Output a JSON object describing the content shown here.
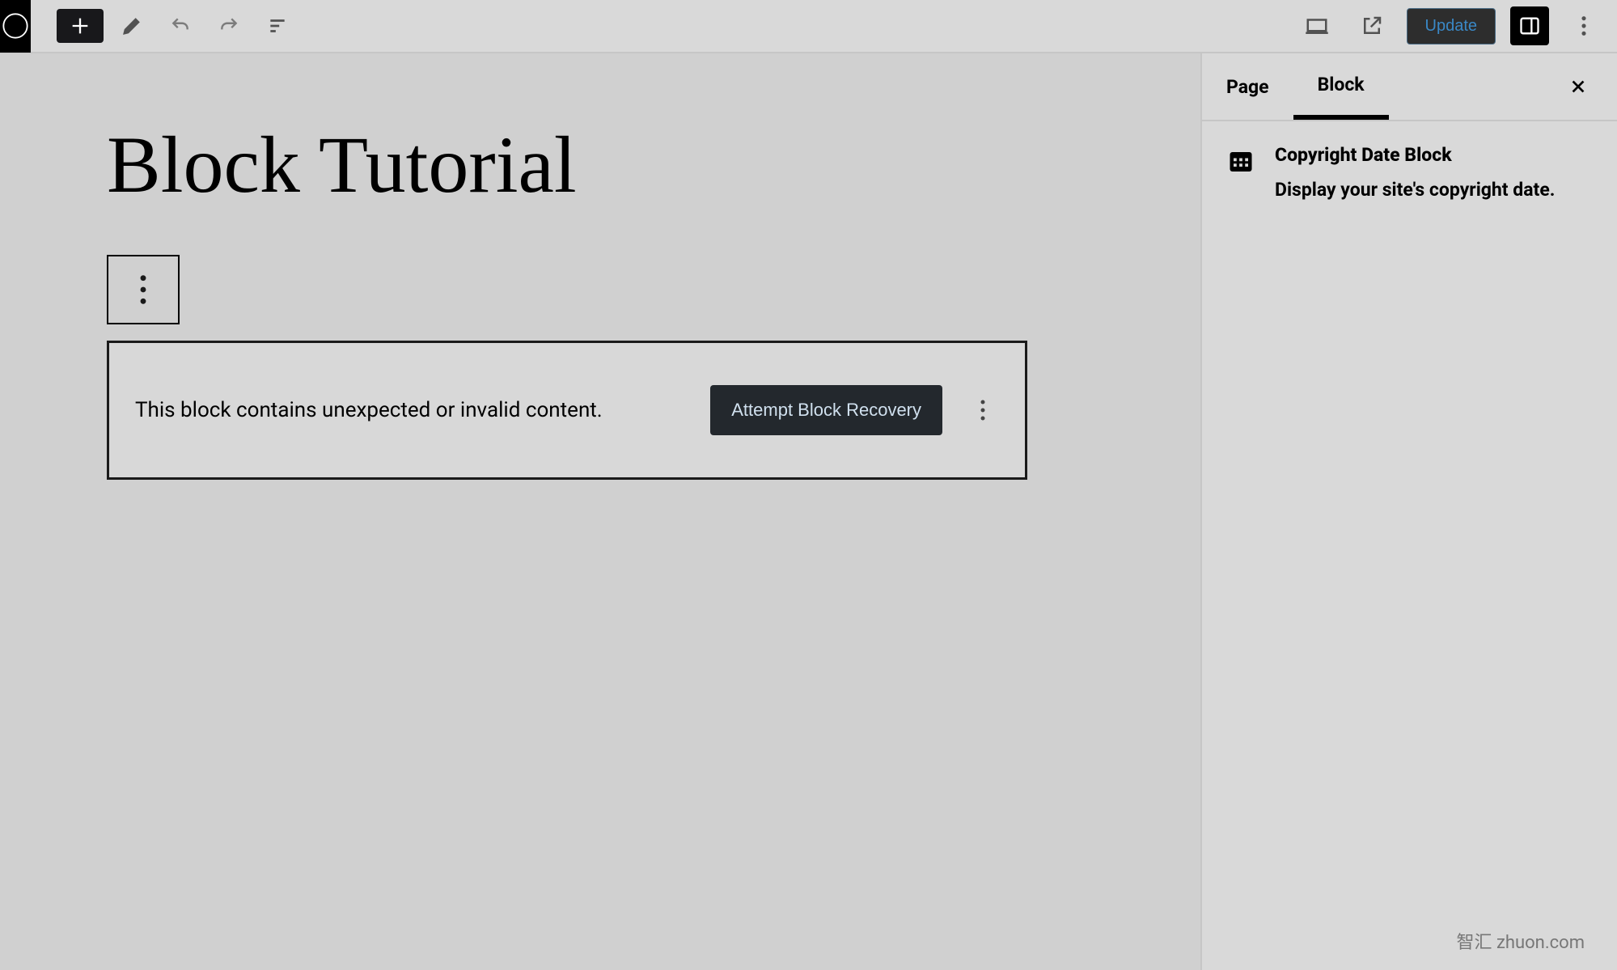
{
  "topbar": {
    "update_label": "Update"
  },
  "canvas": {
    "page_title": "Block Tutorial",
    "error": {
      "message": "This block contains unexpected or invalid content.",
      "recovery_label": "Attempt Block Recovery"
    }
  },
  "sidebar": {
    "tabs": {
      "page": "Page",
      "block": "Block"
    },
    "block_card": {
      "title": "Copyright Date Block",
      "description": "Display your site's copyright date."
    }
  },
  "watermark": "智汇 zhuon.com"
}
